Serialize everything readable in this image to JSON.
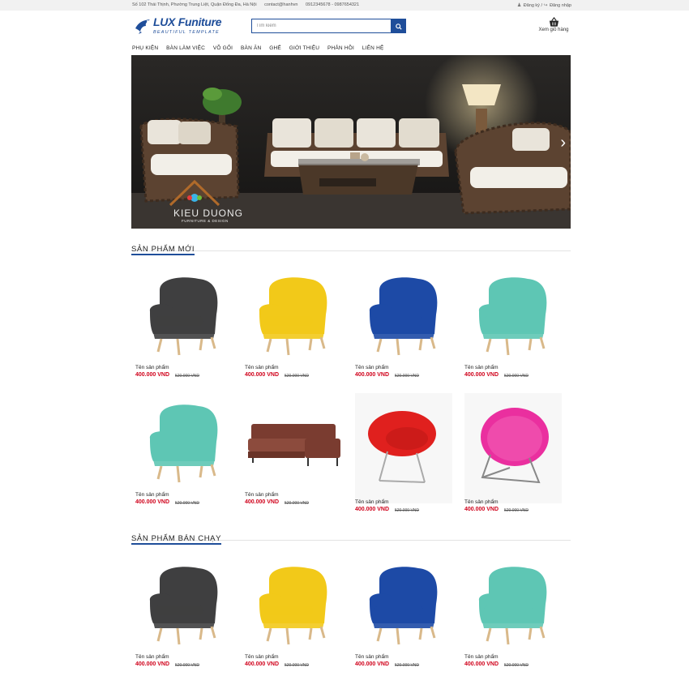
{
  "topbar": {
    "address": "Số 102 Thái Thịnh, Phường Trung Liệt, Quận Đống Đa, Hà Nội",
    "email": "contact@hanhvn",
    "phones": "0912345678 - 0987654321",
    "register": "Đăng ký",
    "separator": "/",
    "login": "Đăng nhập"
  },
  "logo": {
    "brand": "LUX Funiture",
    "tagline": "BEAUTIFUL TEMPLATE"
  },
  "search": {
    "placeholder": "Tìm kiếm"
  },
  "cart": {
    "label": "Xem giỏ hàng"
  },
  "nav": {
    "items": [
      "PHỤ KIỆN",
      "BÀN LÀM VIỆC",
      "VÕ GỐI",
      "BÀN ĂN",
      "GHẾ",
      "GIỚI THIỆU",
      "PHẢN HỒI",
      "LIÊN HỆ"
    ]
  },
  "banner": {
    "watermark": "KIEU DUONG",
    "watermark_sub": "FURNITURE & DESIGN"
  },
  "sections": {
    "new": {
      "title": "SẢN PHẨM MỚI",
      "products": [
        {
          "name": "Tên sản phẩm",
          "price": "400.000 VND",
          "old_price": "520.000 VND",
          "color": "#3f3f40"
        },
        {
          "name": "Tên sản phẩm",
          "price": "400.000 VND",
          "old_price": "520.000 VND",
          "color": "#f2c919"
        },
        {
          "name": "Tên sản phẩm",
          "price": "400.000 VND",
          "old_price": "520.000 VND",
          "color": "#1d4aa6"
        },
        {
          "name": "Tên sản phẩm",
          "price": "400.000 VND",
          "old_price": "520.000 VND",
          "color": "#5ec6b4"
        },
        {
          "name": "Tên sản phẩm",
          "price": "400.000 VND",
          "old_price": "520.000 VND",
          "color": "#5ec6b4"
        },
        {
          "name": "Tên sản phẩm",
          "price": "400.000 VND",
          "old_price": "520.000 VND",
          "color": "#7a3c30"
        },
        {
          "name": "Tên sản phẩm",
          "price": "400.000 VND",
          "old_price": "520.000 VND",
          "color": "#e0201e"
        },
        {
          "name": "Tên sản phẩm",
          "price": "400.000 VND",
          "old_price": "520.000 VND",
          "color": "#ea2f9f"
        }
      ]
    },
    "best": {
      "title": "SẢN PHẨM BÁN CHẠY",
      "products": [
        {
          "name": "Tên sản phẩm",
          "price": "400.000 VND",
          "old_price": "520.000 VND",
          "color": "#3f3f40"
        },
        {
          "name": "Tên sản phẩm",
          "price": "400.000 VND",
          "old_price": "520.000 VND",
          "color": "#f2c919"
        },
        {
          "name": "Tên sản phẩm",
          "price": "400.000 VND",
          "old_price": "520.000 VND",
          "color": "#1d4aa6"
        },
        {
          "name": "Tên sản phẩm",
          "price": "400.000 VND",
          "old_price": "520.000 VND",
          "color": "#5ec6b4"
        }
      ]
    }
  },
  "colors": {
    "accent": "#1f4e9a",
    "price": "#d0021b"
  }
}
